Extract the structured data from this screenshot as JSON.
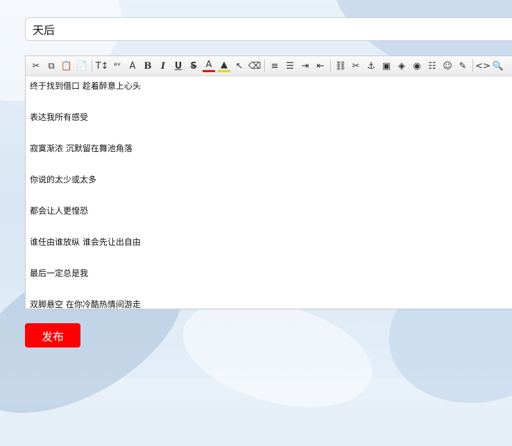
{
  "title_value": "天后",
  "publish_label": "发布",
  "colors": {
    "publish": "#ff0000",
    "font_color_bar": "#e21111",
    "bg_color_bar": "#e6d800"
  },
  "toolbar": [
    {
      "name": "cut-icon",
      "glyph": "✂"
    },
    {
      "name": "copy-icon",
      "glyph": "⧉"
    },
    {
      "name": "paste-icon",
      "glyph": "📋"
    },
    {
      "name": "paste-text-icon",
      "glyph": "📄"
    },
    {
      "sep": true
    },
    {
      "name": "font-size-icon",
      "glyph": "T↕"
    },
    {
      "name": "spell-check-icon",
      "glyph": "ᵃᵛ"
    },
    {
      "name": "font-name-icon",
      "glyph": "A"
    },
    {
      "name": "bold-icon",
      "glyph": "B",
      "cls": "b"
    },
    {
      "name": "italic-icon",
      "glyph": "I",
      "cls": "i"
    },
    {
      "name": "underline-icon",
      "glyph": "U",
      "cls": "u"
    },
    {
      "name": "strikethrough-icon",
      "glyph": "S",
      "cls": "s"
    },
    {
      "name": "font-color-icon",
      "glyph": "A",
      "cls": "red-under"
    },
    {
      "name": "background-color-icon",
      "glyph": "▲",
      "cls": "yellow-under"
    },
    {
      "name": "select-icon",
      "glyph": "↖"
    },
    {
      "name": "eraser-icon",
      "glyph": "⌫"
    },
    {
      "sep": true
    },
    {
      "name": "align-icon",
      "glyph": "≡"
    },
    {
      "name": "list-icon",
      "glyph": "☰"
    },
    {
      "name": "indent-icon",
      "glyph": "⇥"
    },
    {
      "name": "outdent-icon",
      "glyph": "⇤"
    },
    {
      "sep": true
    },
    {
      "name": "link-icon",
      "glyph": "⛓"
    },
    {
      "name": "unlink-icon",
      "glyph": "✂"
    },
    {
      "name": "anchor-icon",
      "glyph": "⚓"
    },
    {
      "name": "image-icon",
      "glyph": "▣"
    },
    {
      "name": "flash-icon",
      "glyph": "◈"
    },
    {
      "name": "media-icon",
      "glyph": "◉"
    },
    {
      "name": "horizontal-rule-icon",
      "glyph": "☷"
    },
    {
      "name": "emoticon-icon",
      "glyph": "☺"
    },
    {
      "name": "edit-icon",
      "glyph": "✎"
    },
    {
      "sep": true
    },
    {
      "name": "source-code-icon",
      "glyph": "<>"
    },
    {
      "name": "preview-icon",
      "glyph": "🔍"
    }
  ],
  "lyrics": [
    "终于找到借口 趁着醉意上心头",
    "表达我所有感受",
    "寂寞渐浓 沉默留在舞池角落",
    "你说的太少或太多",
    "都会让人更惶恐",
    "谁任由谁放纵 谁会先让出自由",
    "最后一定总是我",
    "双脚悬空 在你冷酷热情间游走"
  ]
}
